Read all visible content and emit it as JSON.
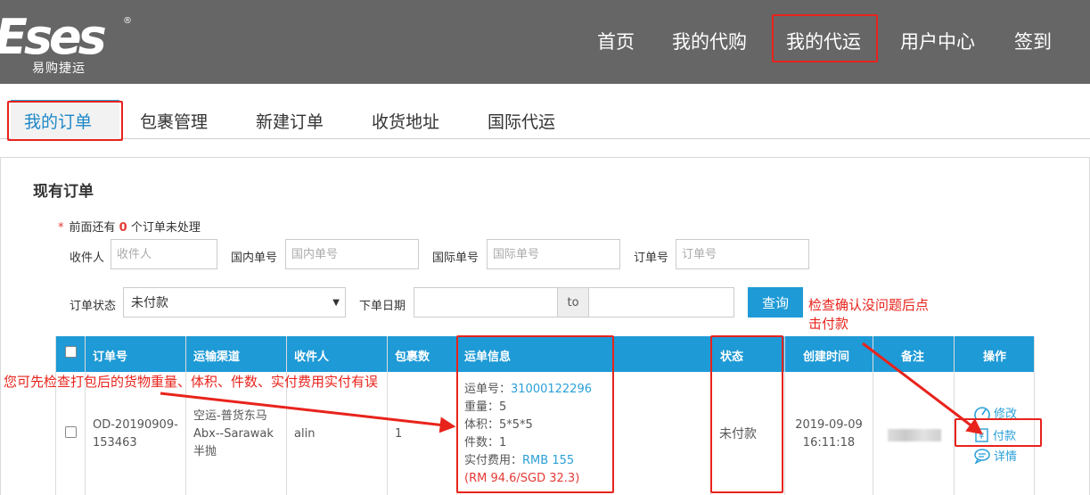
{
  "header": {
    "logo_sub": "易购捷运",
    "nav": [
      "首页",
      "我的代购",
      "我的代运",
      "用户中心",
      "签到"
    ]
  },
  "subtabs": [
    "我的订单",
    "包裹管理",
    "新建订单",
    "收货地址",
    "国际代运"
  ],
  "panel": {
    "title": "现有订单",
    "notice_prefix": "前面还有",
    "notice_count": "0",
    "notice_suffix": "个订单未处理"
  },
  "filters": {
    "recipient_label": "收件人",
    "recipient_placeholder": "收件人",
    "domestic_label": "国内单号",
    "domestic_placeholder": "国内单号",
    "intl_label": "国际单号",
    "intl_placeholder": "国际单号",
    "order_label": "订单号",
    "order_placeholder": "订单号",
    "status_label": "订单状态",
    "status_value": "未付款",
    "date_label": "下单日期",
    "date_to": "to",
    "query_button": "查询"
  },
  "table": {
    "headers": [
      "订单号",
      "运输渠道",
      "收件人",
      "包裹数",
      "运单信息",
      "状态",
      "创建时间",
      "备注",
      "操作"
    ],
    "row": {
      "order_no_1": "OD-20190909-",
      "order_no_2": "153463",
      "channel_1": "空运-普货东马",
      "channel_2": "Abx--Sarawak",
      "channel_3": "半抛",
      "recipient": "alin",
      "packages": "1",
      "waybill_label": "运单号：",
      "waybill_no": "31000122296",
      "weight": "重量：5",
      "volume": "体积：5*5*5",
      "pieces": "件数：1",
      "fee_label": "实付费用：",
      "fee_value": "RMB 155",
      "fee_converted": "(RM 94.6/SGD 32.3)",
      "status": "未付款",
      "created_date": "2019-09-09",
      "created_time": "16:11:18",
      "actions": [
        "修改",
        "付款",
        "详情"
      ]
    }
  },
  "annotations": {
    "left_note": "您可先检查打包后的货物重量、体积、件数、实付费用实付有误",
    "right_note_1": "检查确认没问题后点",
    "right_note_2": "击付款"
  },
  "colors": {
    "header_bg": "#666666",
    "accent_blue": "#1e9ad6",
    "annotation_red": "#e8231c"
  }
}
